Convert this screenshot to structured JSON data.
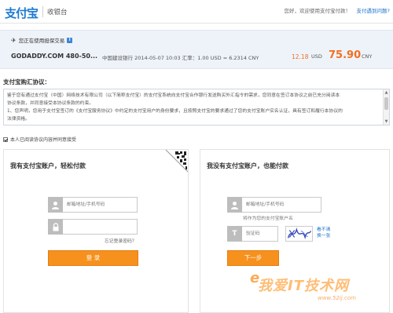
{
  "header": {
    "logo": "支付宝",
    "title": "收银台",
    "welcome": "您好，欢迎使用支付宝付款！",
    "help_link": "支付遇到问题?"
  },
  "order": {
    "note": "您正在使用担保交易",
    "info_icon": "i",
    "merchant": "GODADDY.COM 480-50...",
    "info": "中国建设银行  2014-05-07 10:03 汇率：1.00 USD = 6.2314 CNY",
    "original_amount": "12.18",
    "original_currency": "USD",
    "amount": "75.90",
    "amount_currency": "CNY"
  },
  "agreement": {
    "title": "支付宝购汇协议：",
    "lines": [
      "    鉴于您有通过支付宝（中国）网络技术有限公司（以下简称支付宝）的支付宝系统向支付宝合作银行发送购买外汇指令的需求，您同意在签订本协议之前已充分阅读本",
      "协议条款，并同意接受本协议条款的约束。",
      "1、您声明，您用于支付宝签订的《支付宝服务协议》中约定的支付宝用户的身份要求，且按照支付宝的要求通过了您的支付宝账户实名认证，具有签订和履行本协议的",
      "法律资格。"
    ],
    "checkbox_label": "本人已阅读协议内容并同意接受"
  },
  "login_panel": {
    "title": "我有支付宝账户，轻松付款",
    "account_placeholder": "邮箱地址/手机号码",
    "forgot": "忘记登录密码？",
    "button": "登  录"
  },
  "guest_panel": {
    "title": "我没有支付宝账户，也能付款",
    "account_placeholder": "邮箱地址/手机号码",
    "hint": "将作为您的支付宝账户名",
    "captcha_placeholder": "验证码",
    "captcha_text": "XaW",
    "refresh_line1": "看不清",
    "refresh_line2": "换一张",
    "button": "下一步"
  },
  "watermark": {
    "main": "我爱IT技术网",
    "sub": "www.52ij.com"
  },
  "colors": {
    "brand": "#1e7ad3",
    "accent": "#f7911e",
    "price": "#f26f21"
  }
}
